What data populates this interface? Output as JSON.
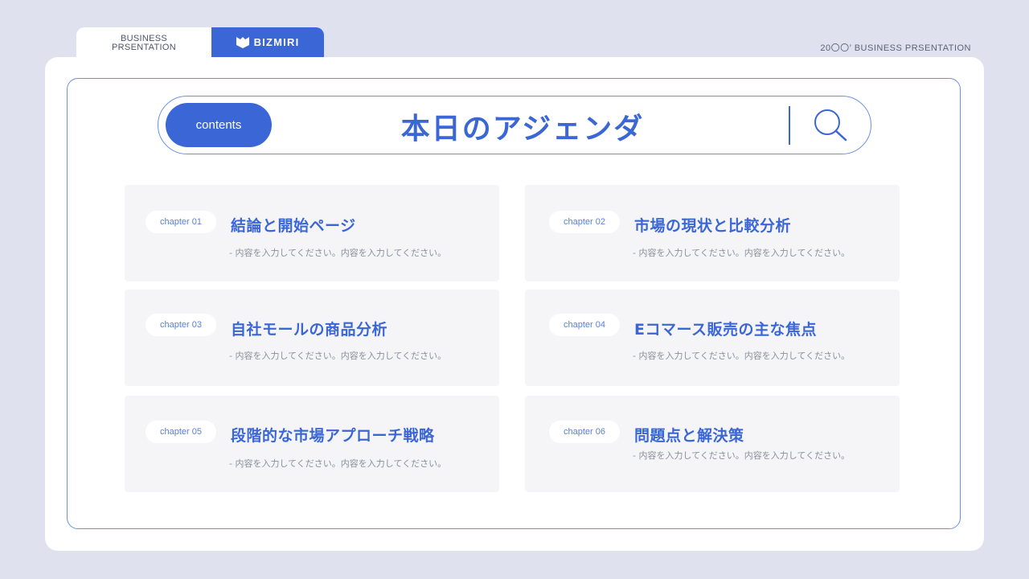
{
  "header": {
    "tab_line1": "BUSINESS",
    "tab_line2": "PRSENTATION",
    "brand_name": "BIZMIRI",
    "brand_icon": "bizmiri-logo-icon",
    "top_right": "20〇〇’ BUSINESS PRSENTATION"
  },
  "agenda": {
    "pill_label": "contents",
    "title": "本日のアジェンダ",
    "search_icon": "search-icon"
  },
  "items": [
    {
      "chapter": "chapter 01",
      "title": "結論と開始ページ",
      "desc": "- 内容を入力してください。内容を入力してください。"
    },
    {
      "chapter": "chapter 02",
      "title": "市場の現状と比較分析",
      "desc": "- 内容を入力してください。内容を入力してください。"
    },
    {
      "chapter": "chapter 03",
      "title": "自社モールの商品分析",
      "desc": "- 内容を入力してください。内容を入力してください。"
    },
    {
      "chapter": "chapter 04",
      "title": "Eコマース販売の主な焦点",
      "desc": "- 内容を入力してください。内容を入力してください。"
    },
    {
      "chapter": "chapter 05",
      "title": "段階的な市場アプローチ戦略",
      "desc": "- 内容を入力してください。内容を入力してください。"
    },
    {
      "chapter": "chapter 06",
      "title": "問題点と解決策",
      "desc": "- 内容を入力してください。内容を入力してください。"
    }
  ],
  "colors": {
    "accent": "#3a66d6",
    "background": "#dfe1ee",
    "item_background": "#f5f5f8"
  }
}
